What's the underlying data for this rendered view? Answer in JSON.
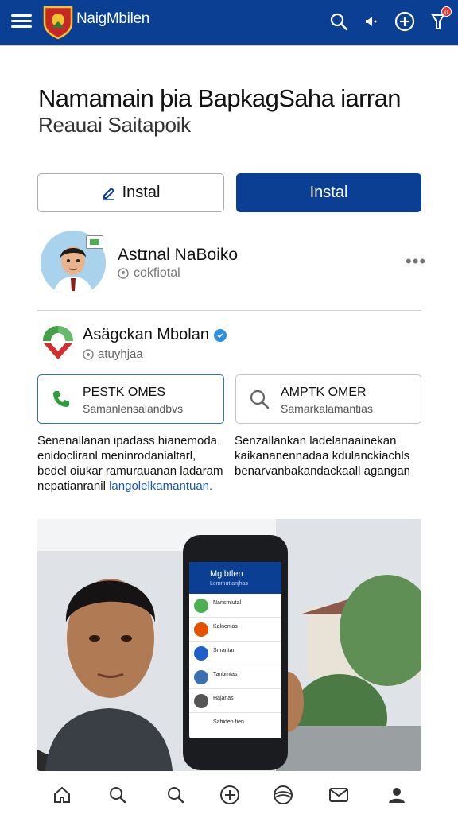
{
  "app": {
    "title": "NaigMbilen",
    "accent": "#0b3f94"
  },
  "topbar": {
    "notification_count": "0"
  },
  "headline": {
    "title": "Namamain þia BapkagSaha iarran",
    "subtitle": "Reauai Saitapoik"
  },
  "actions": {
    "left_label": "Instal",
    "right_label": "Instal"
  },
  "profile": {
    "name": "Astɪnal NaBoiko",
    "handle": "cokfiotal"
  },
  "org": {
    "name": "Asägckan Mbolan",
    "handle": "atuyhjaa"
  },
  "cards": [
    {
      "title": "PESTK OMES",
      "subtitle": "Samanlensalandbvs",
      "icon": "phone-icon"
    },
    {
      "title": "AMPTK OMER",
      "subtitle": "Samarkalamantias",
      "icon": "search-icon"
    }
  ],
  "descriptions": [
    {
      "text": "Senenallanan ipadass hianemoda enidocliranl meninrodanialtarl, bedel oiukar ramurauanan ladaram nepatianranil",
      "link": "langolelkamantuan."
    },
    {
      "text": "Senzallankan ladelanaainekan kaikananennadaa kdulanckiachls benarvanbakandackaall agangan",
      "link": ""
    }
  ],
  "hero_phone": {
    "header_title": "Mgibtlen",
    "header_sub": "Lemmut anjhas",
    "rows": [
      "Nansmlutal",
      "Kalnenlas",
      "Snrantan",
      "Tanbmtas",
      "Hajanas"
    ],
    "footer": "Sabiden fien"
  },
  "bottom_nav": [
    "home-icon",
    "search-icon",
    "explore-icon",
    "add-icon",
    "globe-icon",
    "mail-icon",
    "profile-icon"
  ]
}
